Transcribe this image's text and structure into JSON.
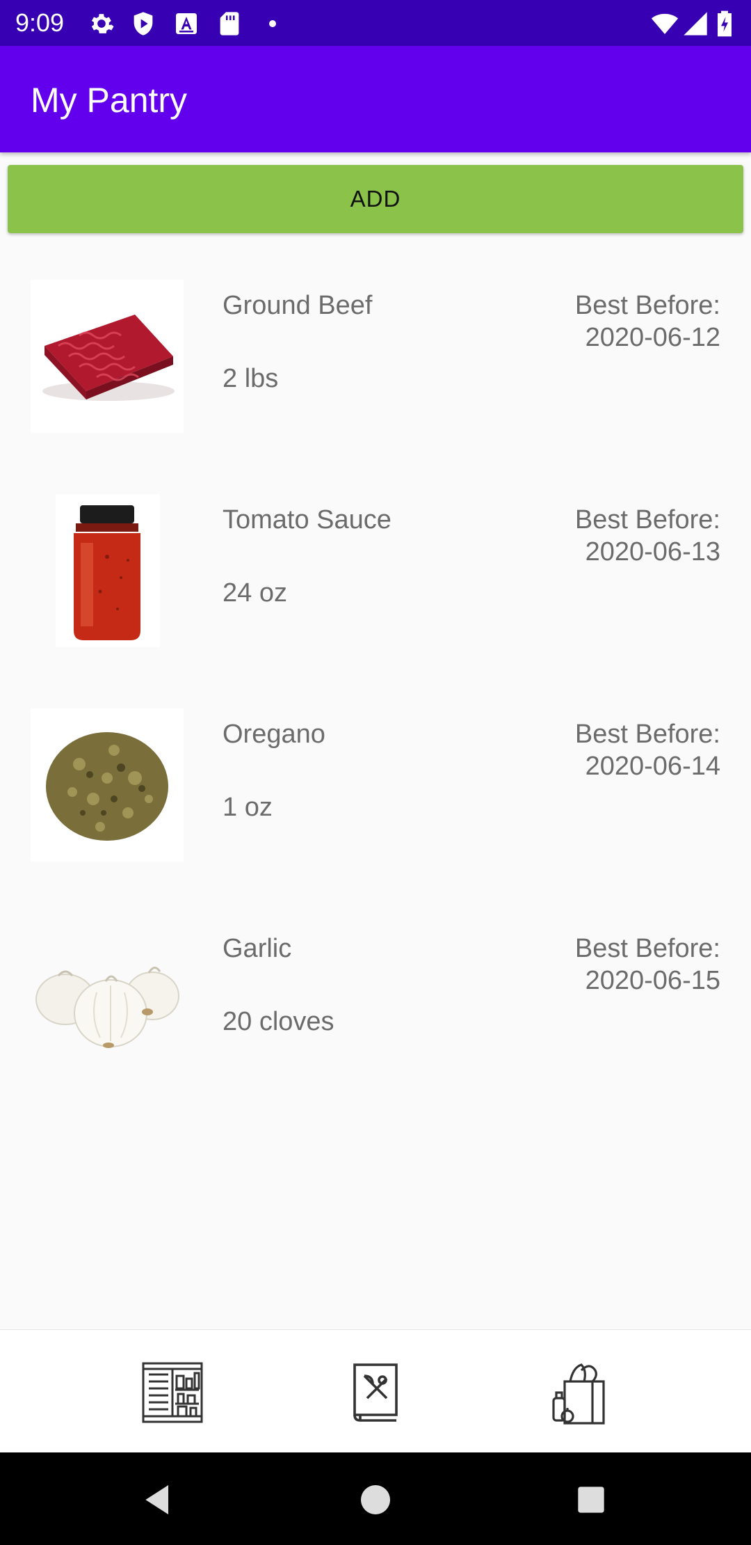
{
  "status_bar": {
    "time": "9:09",
    "icons": [
      "settings-icon",
      "shield-play-icon",
      "text-a-icon",
      "sd-card-icon",
      "dot-icon",
      "wifi-icon",
      "signal-icon",
      "battery-charging-icon"
    ]
  },
  "app_bar": {
    "title": "My Pantry"
  },
  "add_button": {
    "label": "ADD"
  },
  "items": [
    {
      "name": "Ground Beef",
      "quantity": "2 lbs",
      "best_before_label": "Best Before:",
      "best_before_date": "2020-06-12",
      "icon": "ground-beef-image"
    },
    {
      "name": "Tomato Sauce",
      "quantity": "24 oz",
      "best_before_label": "Best Before:",
      "best_before_date": "2020-06-13",
      "icon": "tomato-sauce-image"
    },
    {
      "name": "Oregano",
      "quantity": "1 oz",
      "best_before_label": "Best Before:",
      "best_before_date": "2020-06-14",
      "icon": "oregano-image"
    },
    {
      "name": "Garlic",
      "quantity": "20 cloves",
      "best_before_label": "Best Before:",
      "best_before_date": "2020-06-15",
      "icon": "garlic-image"
    }
  ],
  "bottom_nav": {
    "items": [
      "pantry-icon",
      "recipe-book-icon",
      "grocery-bag-icon"
    ]
  },
  "system_nav": [
    "back-icon",
    "home-icon",
    "recents-icon"
  ],
  "colors": {
    "status_bar": "#3700b3",
    "app_bar": "#6200ee",
    "add_button": "#8bc34a",
    "text_secondary": "#6b6b6b"
  }
}
